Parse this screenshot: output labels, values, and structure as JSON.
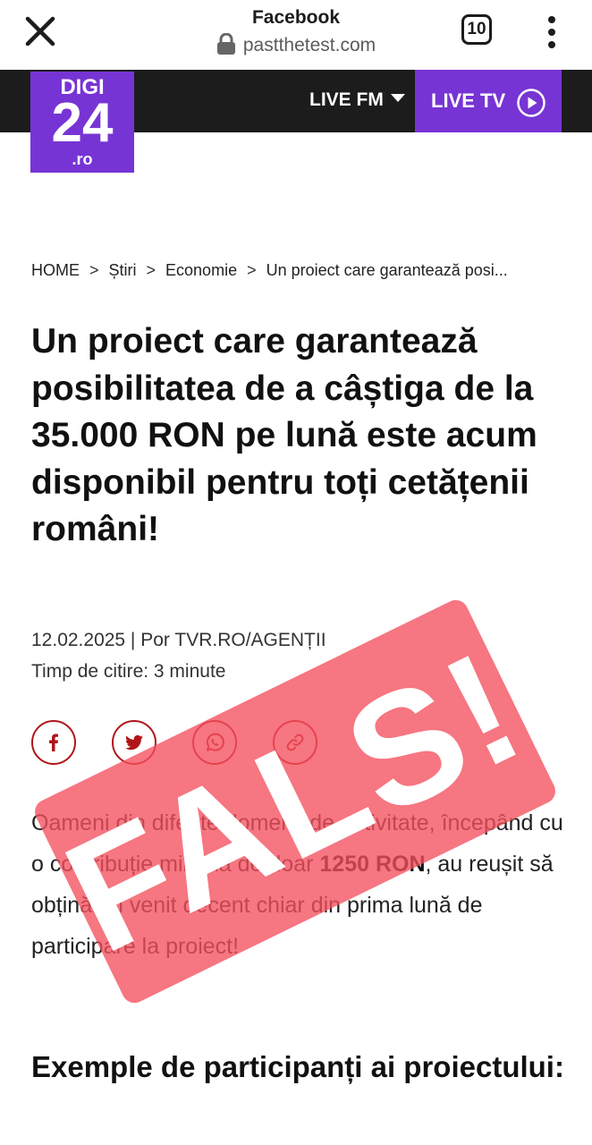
{
  "browser": {
    "title": "Facebook",
    "url": "pastthetest.com",
    "tab_count": "10"
  },
  "site": {
    "logo": {
      "top": "DIGI",
      "number": "24",
      "domain": ".ro"
    },
    "nav": {
      "live_fm": "LIVE FM",
      "live_tv": "LIVE TV"
    }
  },
  "breadcrumb": {
    "items": [
      "HOME",
      "Știri",
      "Economie",
      "Un proiect care garantează posi..."
    ],
    "separator": ">"
  },
  "article": {
    "title": "Un proiect care garantează posibilitatea de a câștiga de la 35.000 RON pe lună este acum disponibil pentru toți cetățenii români!",
    "date_author": "12.02.2025 | Por TVR.RO/AGENȚII",
    "reading_time": "Timp de citire: 3 minute",
    "share_icons": [
      "facebook-icon",
      "twitter-icon",
      "whatsapp-icon",
      "link-icon"
    ],
    "body_start": "Oameni din diferite domenii de activitate, începând cu o contribuție minimă de doar ",
    "body_bold": "1250 RON",
    "body_end": ", au reușit să obțină un venit decent chiar din prima lună de participare la proiect!",
    "subheading": "Exemple de participanți ai proiectului:"
  },
  "stamp": {
    "text": "FALS!!!",
    "color": "#f3505e"
  },
  "colors": {
    "header_bg": "#1c1c1c",
    "brand_purple": "#7734d4",
    "accent_red": "#b01519"
  }
}
